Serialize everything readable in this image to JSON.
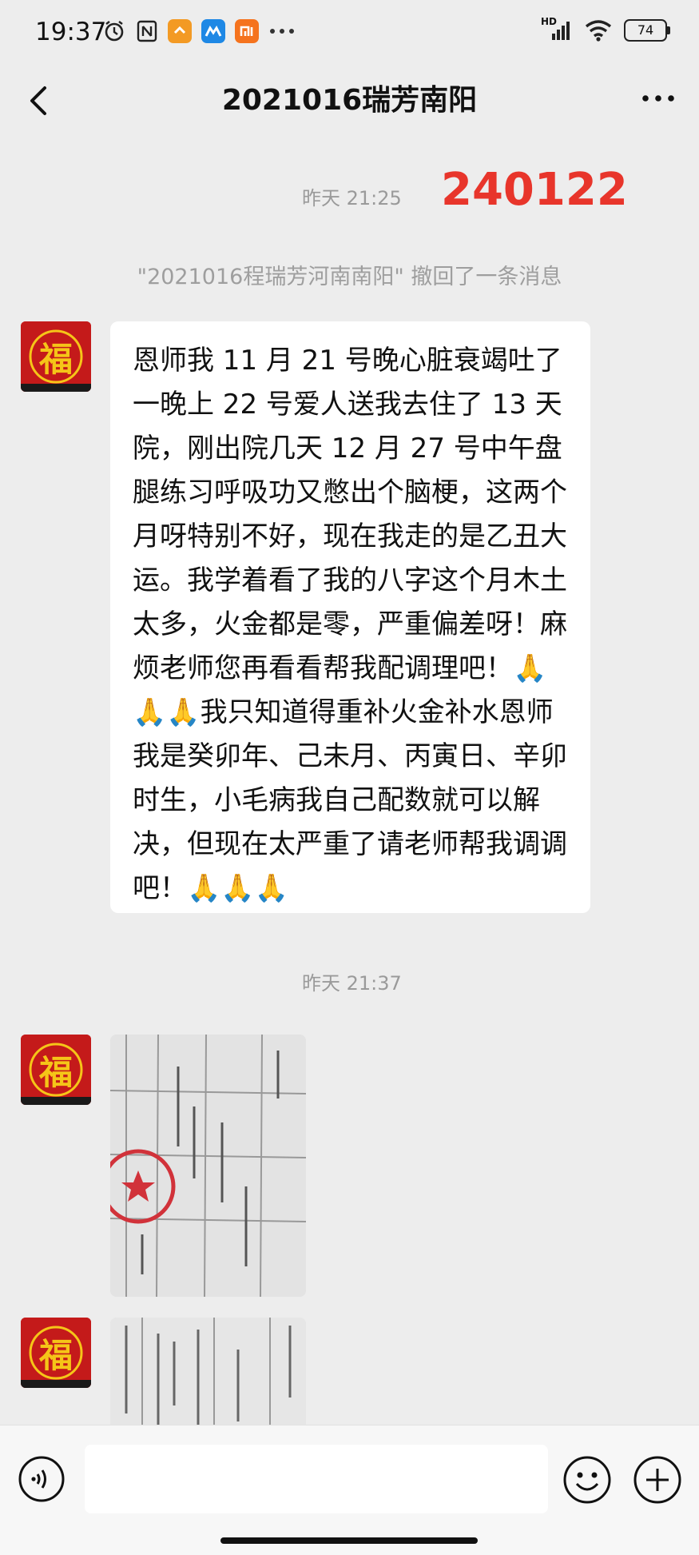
{
  "status_bar": {
    "time": "19:37",
    "left_icons": [
      "alarm-icon",
      "nfc-icon",
      "app-notification-icon",
      "app-notification-icon",
      "mi-icon",
      "more-dots-icon"
    ],
    "network": "HD",
    "battery": "74"
  },
  "header": {
    "title": "2021016瑞芳南阳",
    "back_icon": "chevron-left-icon",
    "more_icon": "more-horizontal-icon"
  },
  "chat": {
    "timestamp_1": "昨天 21:25",
    "annotation": "240122",
    "recall_notice": "\"2021016程瑞芳河南南阳\" 撤回了一条消息",
    "message_text": "恩师我 11 月 21 号晚心脏衰竭吐了一晚上 22 号爱人送我去住了 13 天院，刚出院几天 12 月 27 号中午盘腿练习呼吸功又憋出个脑梗，这两个月呀特别不好，现在我走的是乙丑大运。我学着看了我的八字这个月木土太多，火金都是零，严重偏差呀！麻烦老师您再看看帮我配调理吧！🙏🙏🙏我只知道得重补火金补水恩师我是癸卯年、己未月、丙寅日、辛卯时生，小毛病我自己配数就可以解决，但现在太严重了请老师帮我调调吧！🙏🙏🙏",
    "timestamp_2": "昨天 21:37",
    "avatar_char": "福"
  },
  "input_bar": {
    "voice_icon": "voice-icon",
    "emoji_icon": "emoji-icon",
    "plus_icon": "plus-icon"
  },
  "colors": {
    "background": "#ededed",
    "annotation_red": "#e8352b",
    "avatar_red": "#c41a1a",
    "avatar_gold": "#f5c518"
  }
}
